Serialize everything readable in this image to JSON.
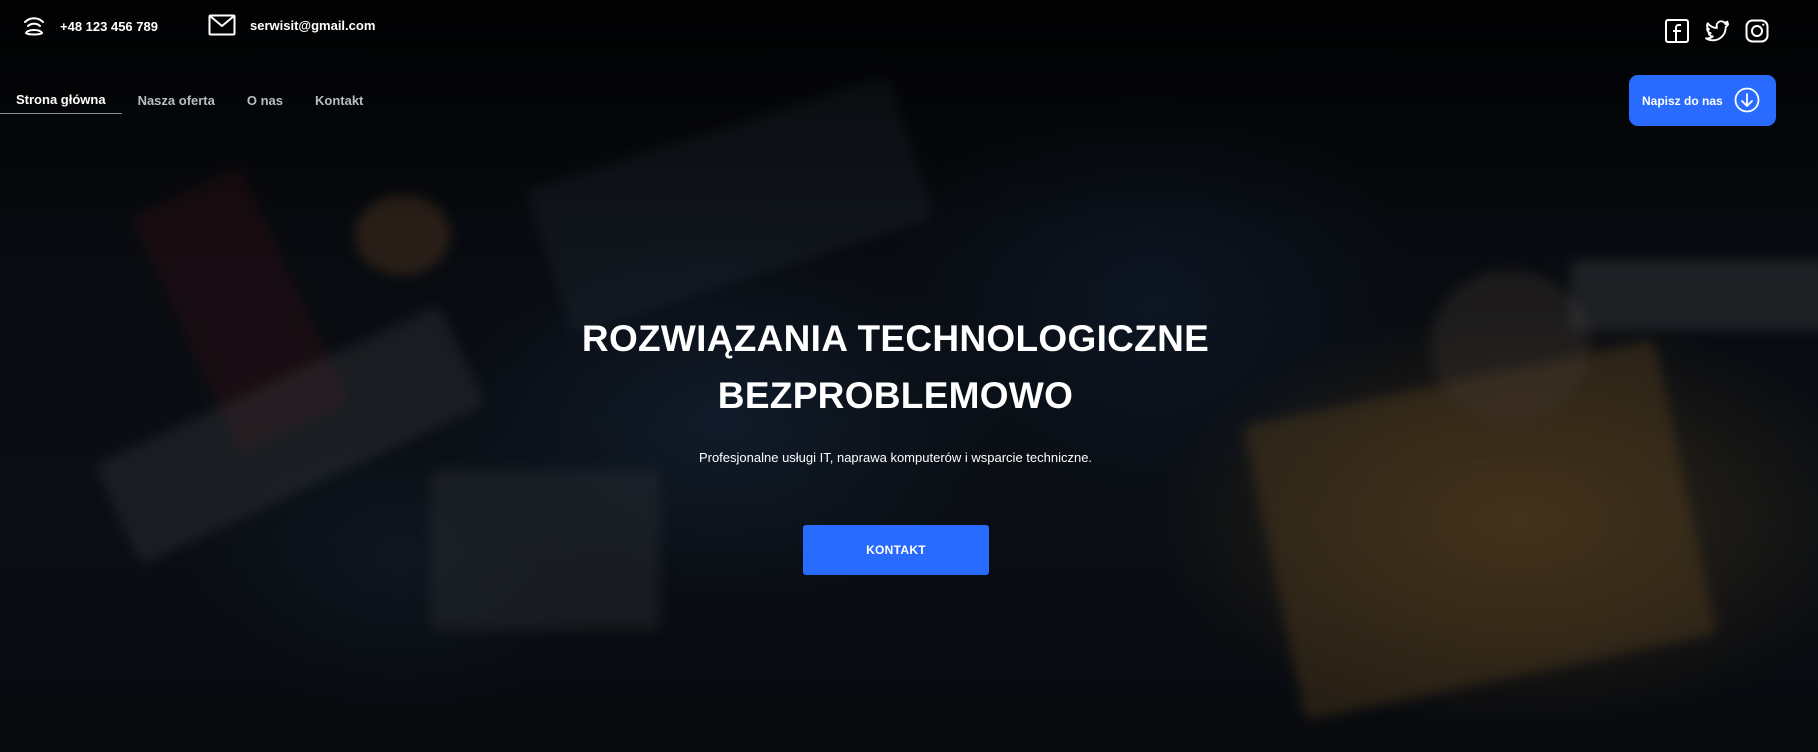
{
  "contact": {
    "phone": "+48 123 456 789",
    "email": "serwisit@gmail.com"
  },
  "social": {
    "icons": [
      "facebook-icon",
      "twitter-icon",
      "instagram-icon"
    ]
  },
  "nav": {
    "items": [
      {
        "label": "Strona główna",
        "active": true
      },
      {
        "label": "Nasza oferta",
        "active": false
      },
      {
        "label": "O nas",
        "active": false
      },
      {
        "label": "Kontakt",
        "active": false
      }
    ]
  },
  "cta_top": {
    "label": "Napisz do nas",
    "icon": "arrow-down-circle-icon"
  },
  "hero": {
    "title_line1": "ROZWIĄZANIA TECHNOLOGICZNE",
    "title_line2": "BEZPROBLEMOWO",
    "subtitle": "Profesjonalne usługi IT, naprawa komputerów i wsparcie techniczne.",
    "button_label": "KONTAKT"
  },
  "colors": {
    "accent": "#2a6bff",
    "text": "#ffffff",
    "nav_inactive": "#b9bcc3"
  }
}
